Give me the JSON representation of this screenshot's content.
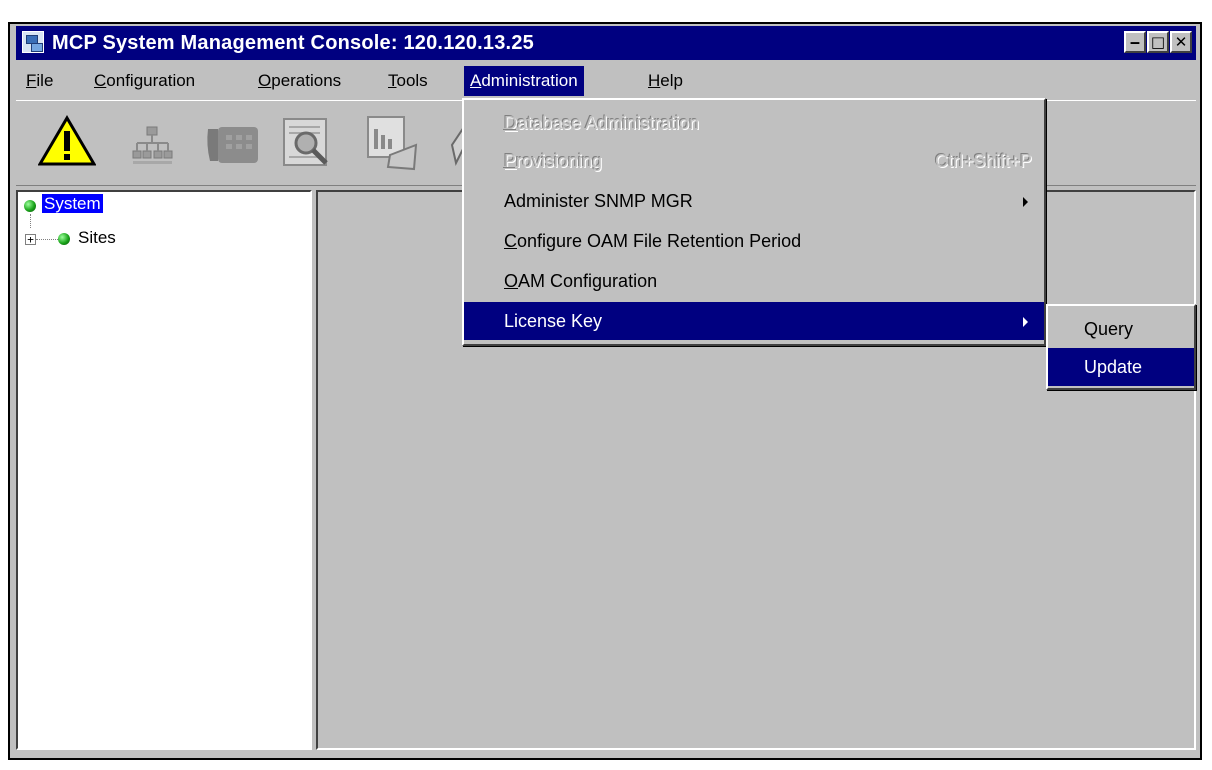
{
  "window": {
    "title": "MCP System Management Console: 120.120.13.25",
    "controls": {
      "minimize": "‒",
      "maximize": "□",
      "close": "✕"
    }
  },
  "menubar": {
    "items": [
      {
        "label": "File",
        "mnemonic": "F",
        "rest": "ile"
      },
      {
        "label": "Configuration",
        "mnemonic": "C",
        "rest": "onfiguration"
      },
      {
        "label": "Operations",
        "mnemonic": "O",
        "rest": "perations"
      },
      {
        "label": "Tools",
        "mnemonic": "T",
        "rest": "ools"
      },
      {
        "label": "Administration",
        "mnemonic": "A",
        "rest": "dministration"
      },
      {
        "label": "Help",
        "mnemonic": "H",
        "rest": "elp"
      }
    ],
    "active": "Administration"
  },
  "toolbar": {
    "icons": [
      "warning-icon",
      "network-topology-icon",
      "phone-icon",
      "search-document-icon",
      "chart-document-icon",
      "pen-icon"
    ]
  },
  "tree": {
    "root": {
      "label": "System",
      "status": "green"
    },
    "children": [
      {
        "label": "Sites",
        "status": "green",
        "expanded": false
      }
    ]
  },
  "administration_menu": {
    "items": [
      {
        "label": "Database Administration",
        "mnemonic": "D",
        "rest": "atabase Administration",
        "enabled": false
      },
      {
        "label": "Provisioning",
        "mnemonic": "P",
        "rest": "rovisioning",
        "shortcut": "Ctrl+Shift+P",
        "enabled": false
      },
      {
        "label": "Administer SNMP MGR",
        "enabled": true,
        "submenu": true
      },
      {
        "label": "Configure OAM File Retention Period",
        "mnemonic": "C",
        "rest": "onfigure OAM File Retention Period",
        "enabled": true
      },
      {
        "label": "OAM Configuration",
        "mnemonic": "O",
        "rest": "AM Configuration",
        "enabled": true
      },
      {
        "label": "License Key",
        "enabled": true,
        "submenu": true,
        "selected": true
      }
    ]
  },
  "license_key_submenu": {
    "items": [
      {
        "label": "Query",
        "selected": false
      },
      {
        "label": "Update",
        "selected": true
      }
    ]
  },
  "colors": {
    "titlebar": "#000080",
    "menu_highlight": "#000080",
    "tree_selection": "#0000ff",
    "window_bg": "#c0c0c0"
  }
}
